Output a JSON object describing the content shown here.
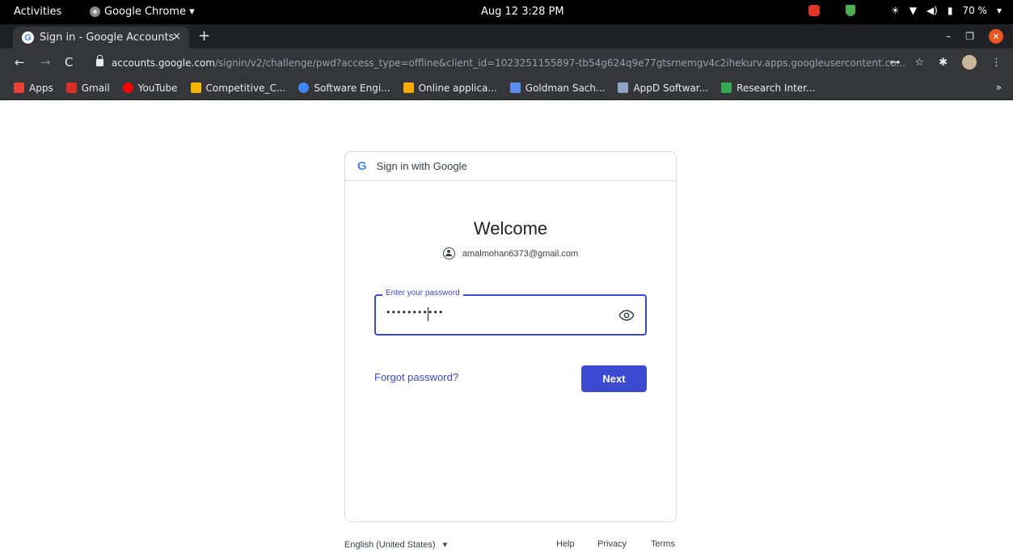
{
  "os_bar": {
    "activities": "Activities",
    "app_name": "Google Chrome ▾",
    "clock": "Aug 12  3:28 PM",
    "battery": "70 %",
    "tray_icons": [
      "app-indicator-icon",
      "shield-icon",
      "brightness-icon",
      "wifi-icon",
      "volume-icon",
      "battery-icon"
    ]
  },
  "browser": {
    "tab_title": "Sign in - Google Accounts",
    "tab_close": "×",
    "new_tab": "+",
    "url_host": "accounts.google.com",
    "url_path": "/signin/v2/challenge/pwd?access_type=offline&client_id=1023251155897-tb54g624q9e77gtsrnemgv4c2ihekurv.apps.googleusercontent.co...",
    "bookmarks": [
      {
        "label": "Apps",
        "color": "#ea4335"
      },
      {
        "label": "Gmail",
        "color": "#d93025"
      },
      {
        "label": "YouTube",
        "color": "#ff0000"
      },
      {
        "label": "Competitive_C...",
        "color": "#f4b400"
      },
      {
        "label": "Software Engi...",
        "color": "#4285f4"
      },
      {
        "label": "Online applica...",
        "color": "#f9ab00"
      },
      {
        "label": "Goldman Sach...",
        "color": "#5b8def"
      },
      {
        "label": "AppD Softwar...",
        "color": "#8fa3c7"
      },
      {
        "label": "Research Inter...",
        "color": "#34a853"
      }
    ],
    "bookmarks_more": "»"
  },
  "signin": {
    "header": "Sign in with Google",
    "welcome": "Welcome",
    "email": "amalmohan6373@gmail.com",
    "password_label": "Enter your password",
    "password_value": "•••••••••••",
    "forgot": "Forgot password?",
    "next": "Next",
    "accent": "#3c4ad1"
  },
  "footer": {
    "language": "English (United States)",
    "help": "Help",
    "privacy": "Privacy",
    "terms": "Terms"
  }
}
